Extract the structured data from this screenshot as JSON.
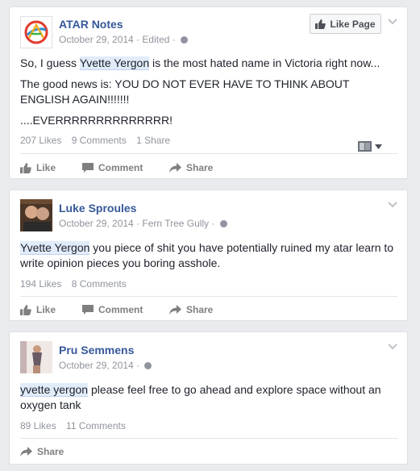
{
  "posts": [
    {
      "author": "ATAR Notes",
      "date": "October 29, 2014",
      "meta_suffix": "Edited",
      "like_page_label": "Like Page",
      "paragraphs": [
        {
          "pre": "So, I guess ",
          "hl": "Yvette Yergon",
          "post": " is the most hated name in Victoria right now..."
        },
        {
          "pre": "The good news is: YOU DO NOT EVER HAVE TO THINK ABOUT ENGLISH AGAIN!!!!!!!",
          "hl": "",
          "post": ""
        },
        {
          "pre": "....EVERRRRRRRRRRRRRR!",
          "hl": "",
          "post": ""
        }
      ],
      "likes": "207 Likes",
      "comments": "9 Comments",
      "shares": "1 Share",
      "actions": {
        "like": "Like",
        "comment": "Comment",
        "share": "Share"
      }
    },
    {
      "author": "Luke Sproules",
      "date": "October 29, 2014",
      "meta_suffix": "Fern Tree Gully",
      "paragraphs": [
        {
          "pre": "",
          "hl": "Yvette Yergon",
          "post": " you piece of shit you have potentially ruined my atar learn to write opinion pieces you boring asshole."
        }
      ],
      "likes": "194 Likes",
      "comments": "8 Comments",
      "actions": {
        "like": "Like",
        "comment": "Comment",
        "share": "Share"
      }
    },
    {
      "author": "Pru Semmens",
      "date": "October 29, 2014",
      "paragraphs": [
        {
          "pre": "",
          "hl": "yvette yergon",
          "post": " please feel free to go ahead and explore space without an oxygen tank"
        }
      ],
      "likes": "89 Likes",
      "comments": "11 Comments",
      "actions": {
        "share": "Share"
      }
    }
  ],
  "icons": {
    "like": "thumbs-up-icon",
    "comment": "speech-bubble-icon",
    "share": "share-arrow-icon",
    "privacy": "globe-icon",
    "menu": "chevron-down-icon"
  },
  "colors": {
    "author_link": "#365899",
    "meta_text": "#90949c",
    "highlight": "#e1ecfb",
    "background": "#e9ebee"
  }
}
